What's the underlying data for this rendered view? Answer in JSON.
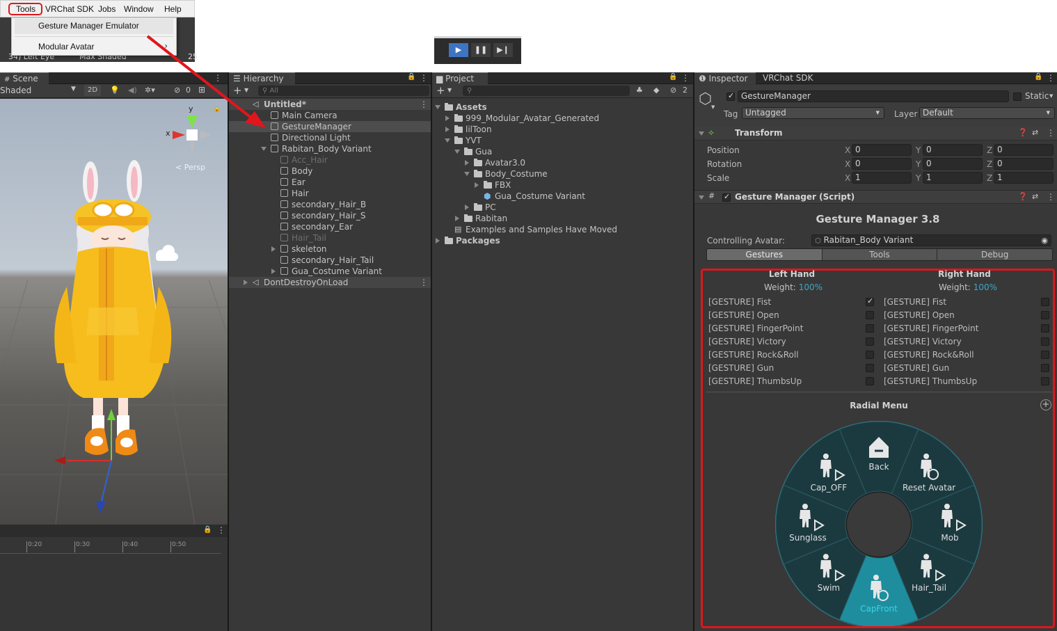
{
  "menubar": {
    "items": [
      "Tools",
      "VRChat SDK",
      "Jobs",
      "Window",
      "Help"
    ]
  },
  "tools_menu": {
    "items": [
      "Gesture Manager Emulator",
      "Modular Avatar"
    ],
    "peek_left": "34)  Left Eye",
    "peek_right": "Max Shaded",
    "peek_num": "25"
  },
  "scene": {
    "tab": "Scene",
    "shading": "Shaded",
    "mode_2d": "2D",
    "hidden_count": "0",
    "gizmo": {
      "y": "y",
      "x": "x",
      "persp": "< Persp"
    }
  },
  "timeline": {
    "ticks": [
      "0:20",
      "0:30",
      "0:40",
      "0:50"
    ]
  },
  "hierarchy": {
    "tab": "Hierarchy",
    "search_placeholder": "All",
    "items": [
      {
        "label": "Untitled*",
        "depth": 0,
        "bold": true,
        "kind": "scene"
      },
      {
        "label": "Main Camera",
        "depth": 1
      },
      {
        "label": "GestureManager",
        "depth": 1,
        "selected": true
      },
      {
        "label": "Directional Light",
        "depth": 1
      },
      {
        "label": "Rabitan_Body Variant",
        "depth": 1,
        "expanded": true
      },
      {
        "label": "Acc_Hair",
        "depth": 2,
        "dim": true
      },
      {
        "label": "Body",
        "depth": 2
      },
      {
        "label": "Ear",
        "depth": 2
      },
      {
        "label": "Hair",
        "depth": 2
      },
      {
        "label": "secondary_Hair_B",
        "depth": 2
      },
      {
        "label": "secondary_Hair_S",
        "depth": 2
      },
      {
        "label": "secondary_Ear",
        "depth": 2
      },
      {
        "label": "Hair_Tail",
        "depth": 2,
        "dim": true
      },
      {
        "label": "skeleton",
        "depth": 2,
        "collapsed": true
      },
      {
        "label": "secondary_Hair_Tail",
        "depth": 2
      },
      {
        "label": "Gua_Costume Variant",
        "depth": 2,
        "collapsed": true
      },
      {
        "label": "DontDestroyOnLoad",
        "depth": 0,
        "kind": "scene",
        "collapsed": true
      }
    ]
  },
  "project": {
    "tab": "Project",
    "badge": "2",
    "items": [
      {
        "label": "Assets",
        "depth": 0,
        "bold": true,
        "expanded": true
      },
      {
        "label": "999_Modular_Avatar_Generated",
        "depth": 1,
        "collapsed": true
      },
      {
        "label": "lilToon",
        "depth": 1,
        "collapsed": true
      },
      {
        "label": "YVT",
        "depth": 1,
        "expanded": true
      },
      {
        "label": "Gua",
        "depth": 2,
        "expanded": true
      },
      {
        "label": "Avatar3.0",
        "depth": 3,
        "collapsed": true
      },
      {
        "label": "Body_Costume",
        "depth": 3,
        "expanded": true
      },
      {
        "label": "FBX",
        "depth": 4,
        "collapsed": true
      },
      {
        "label": "Gua_Costume Variant",
        "depth": 4,
        "kind": "prefab"
      },
      {
        "label": "PC",
        "depth": 3,
        "collapsed": true
      },
      {
        "label": "Rabitan",
        "depth": 2,
        "collapsed": true
      },
      {
        "label": "Examples and Samples Have Moved",
        "depth": 1,
        "kind": "file"
      },
      {
        "label": "Packages",
        "depth": 0,
        "bold": true,
        "collapsed": true
      }
    ]
  },
  "inspector": {
    "tabs": [
      "Inspector",
      "VRChat SDK"
    ],
    "object_name": "GestureManager",
    "static_label": "Static",
    "tag_label": "Tag",
    "tag_value": "Untagged",
    "layer_label": "Layer",
    "layer_value": "Default",
    "transform": {
      "title": "Transform",
      "rows": [
        {
          "label": "Position",
          "x": "0",
          "y": "0",
          "z": "0"
        },
        {
          "label": "Rotation",
          "x": "0",
          "y": "0",
          "z": "0"
        },
        {
          "label": "Scale",
          "x": "1",
          "y": "1",
          "z": "1"
        }
      ]
    },
    "script": {
      "title": "Gesture Manager (Script)",
      "heading": "Gesture Manager 3.8",
      "controlling_label": "Controlling Avatar:",
      "controlling_value": "Rabitan_Body Variant",
      "tabs": [
        "Gestures",
        "Tools",
        "Debug"
      ]
    },
    "hands": {
      "left": {
        "title": "Left Hand",
        "weight_label": "Weight:",
        "weight": "100%"
      },
      "right": {
        "title": "Right Hand",
        "weight_label": "Weight:",
        "weight": "100%"
      },
      "gestures": [
        "[GESTURE] Fist",
        "[GESTURE] Open",
        "[GESTURE] FingerPoint",
        "[GESTURE] Victory",
        "[GESTURE] Rock&Roll",
        "[GESTURE] Gun",
        "[GESTURE] ThumbsUp"
      ],
      "left_checked": [
        true,
        false,
        false,
        false,
        false,
        false,
        false
      ],
      "right_checked": [
        false,
        false,
        false,
        false,
        false,
        false,
        false
      ]
    },
    "radial": {
      "title": "Radial Menu",
      "items": [
        "Back",
        "Reset Avatar",
        "Mob",
        "Hair_Tail",
        "CapFront",
        "Swim",
        "Sunglass",
        "Cap_OFF"
      ],
      "selected": "CapFront"
    }
  },
  "colors": {
    "accent": "#2a8fa3",
    "highlight_red": "#e0161c",
    "weight": "#3ea7c8",
    "selected_row": "#4a4a4a",
    "panel": "#383838",
    "yellow": "#f2bb1d"
  }
}
